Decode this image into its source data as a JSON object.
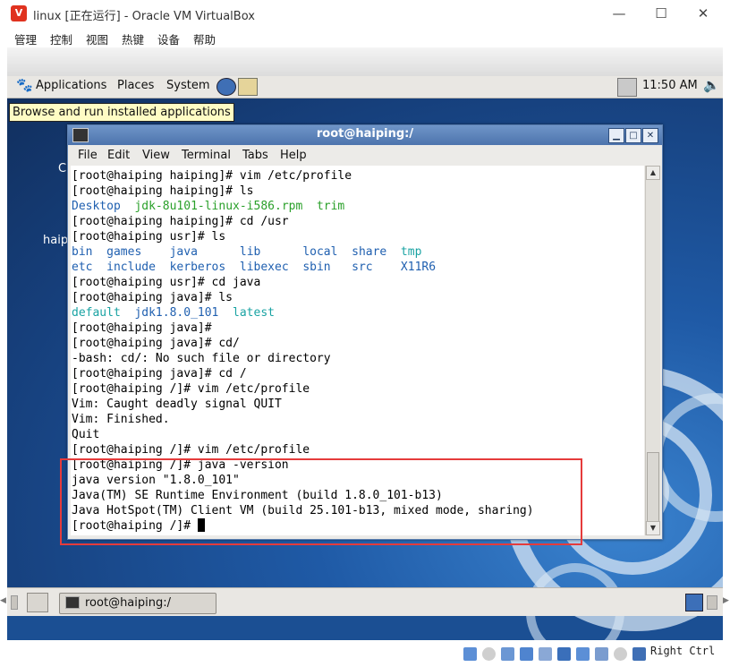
{
  "window": {
    "title": "linux [正在运行] - Oracle VM VirtualBox",
    "app_icon": "virtualbox-icon"
  },
  "vbox_menu": [
    "管理",
    "控制",
    "视图",
    "热键",
    "设备",
    "帮助"
  ],
  "window_controls": {
    "minimize": "—",
    "maximize": "☐",
    "close": "✕"
  },
  "gnome_panel": {
    "menus": [
      "Applications",
      "Places",
      "System"
    ],
    "clock": "11:50 AM",
    "tooltip": "Browse and run installed applications"
  },
  "desktop": {
    "label_partial_1": "C",
    "label_partial_2": "haip"
  },
  "terminal": {
    "title": "root@haiping:/",
    "menus": [
      "File",
      "Edit",
      "View",
      "Terminal",
      "Tabs",
      "Help"
    ],
    "lines": [
      [
        {
          "t": "[root@haiping haiping]# vim /etc/profile"
        }
      ],
      [
        {
          "t": "[root@haiping haiping]# ls"
        }
      ],
      [
        {
          "t": "Desktop",
          "c": "blue"
        },
        {
          "t": "  "
        },
        {
          "t": "jdk-8u101-linux-i586.rpm",
          "c": "green"
        },
        {
          "t": "  "
        },
        {
          "t": "trim",
          "c": "green"
        }
      ],
      [
        {
          "t": "[root@haiping haiping]# cd /usr"
        }
      ],
      [
        {
          "t": "[root@haiping usr]# ls"
        }
      ],
      [
        {
          "t": "bin",
          "c": "blue"
        },
        {
          "t": "  "
        },
        {
          "t": "games",
          "c": "blue"
        },
        {
          "t": "    "
        },
        {
          "t": "java",
          "c": "blue"
        },
        {
          "t": "      "
        },
        {
          "t": "lib",
          "c": "blue"
        },
        {
          "t": "      "
        },
        {
          "t": "local",
          "c": "blue"
        },
        {
          "t": "  "
        },
        {
          "t": "share",
          "c": "blue"
        },
        {
          "t": "  "
        },
        {
          "t": "tmp",
          "c": "cyan"
        }
      ],
      [
        {
          "t": "etc",
          "c": "blue"
        },
        {
          "t": "  "
        },
        {
          "t": "include",
          "c": "blue"
        },
        {
          "t": "  "
        },
        {
          "t": "kerberos",
          "c": "blue"
        },
        {
          "t": "  "
        },
        {
          "t": "libexec",
          "c": "blue"
        },
        {
          "t": "  "
        },
        {
          "t": "sbin",
          "c": "blue"
        },
        {
          "t": "   "
        },
        {
          "t": "src",
          "c": "blue"
        },
        {
          "t": "    "
        },
        {
          "t": "X11R6",
          "c": "blue"
        }
      ],
      [
        {
          "t": "[root@haiping usr]# cd java"
        }
      ],
      [
        {
          "t": "[root@haiping java]# ls"
        }
      ],
      [
        {
          "t": "default",
          "c": "cyan"
        },
        {
          "t": "  "
        },
        {
          "t": "jdk1.8.0_101",
          "c": "blue"
        },
        {
          "t": "  "
        },
        {
          "t": "latest",
          "c": "cyan"
        }
      ],
      [
        {
          "t": "[root@haiping java]#"
        }
      ],
      [
        {
          "t": "[root@haiping java]# cd/"
        }
      ],
      [
        {
          "t": "-bash: cd/: No such file or directory"
        }
      ],
      [
        {
          "t": "[root@haiping java]# cd /"
        }
      ],
      [
        {
          "t": "[root@haiping /]# vim /etc/profile"
        }
      ],
      [
        {
          "t": "Vim: Caught deadly signal QUIT"
        }
      ],
      [
        {
          "t": "Vim: Finished."
        }
      ],
      [
        {
          "t": "Quit"
        }
      ],
      [
        {
          "t": "[root@haiping /]# vim /etc/profile"
        }
      ],
      [
        {
          "t": "[root@haiping /]# java -version"
        }
      ],
      [
        {
          "t": "java version \"1.8.0_101\""
        }
      ],
      [
        {
          "t": "Java(TM) SE Runtime Environment (build 1.8.0_101-b13)"
        }
      ],
      [
        {
          "t": "Java HotSpot(TM) Client VM (build 25.101-b13, mixed mode, sharing)"
        }
      ],
      [
        {
          "t": "[root@haiping /]# "
        }
      ]
    ]
  },
  "taskbar": {
    "task_label": "root@haiping:/"
  },
  "vbox_status": {
    "host_key": "Right Ctrl"
  },
  "colors": {
    "highlight": "#e53b3b",
    "ls_dir": "#2060b0",
    "ls_file": "#2aa02a",
    "ls_link": "#1aa3a3"
  }
}
